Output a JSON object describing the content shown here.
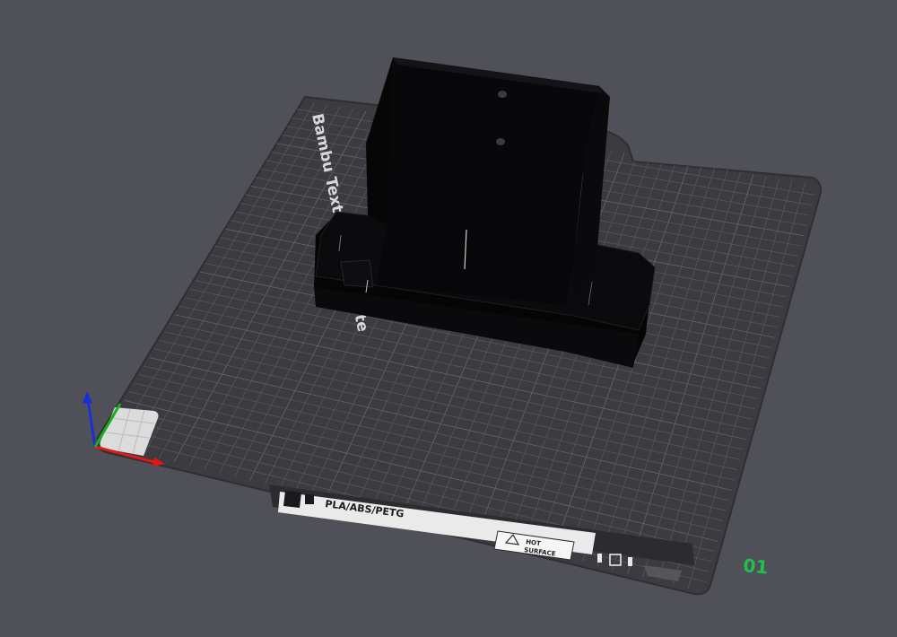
{
  "plate": {
    "name": "Bambu Textured PEI Plate",
    "material_label": "PLA/ABS/PETG",
    "warning_line1": "HOT",
    "warning_line2": "SURFACE",
    "plate_number": "01"
  },
  "colors": {
    "background": "#505158",
    "plate": "#3b3b40",
    "grid": "#55565c",
    "model": "#050506",
    "plate_number": "#1fc14c",
    "axis_x": "#e01818",
    "axis_y": "#19b319",
    "axis_z": "#1a2fd6"
  },
  "icons": [
    "plate-logo-icon",
    "warning-triangle-icon",
    "orientation-arrows-icon",
    "axis-gizmo-icon"
  ]
}
